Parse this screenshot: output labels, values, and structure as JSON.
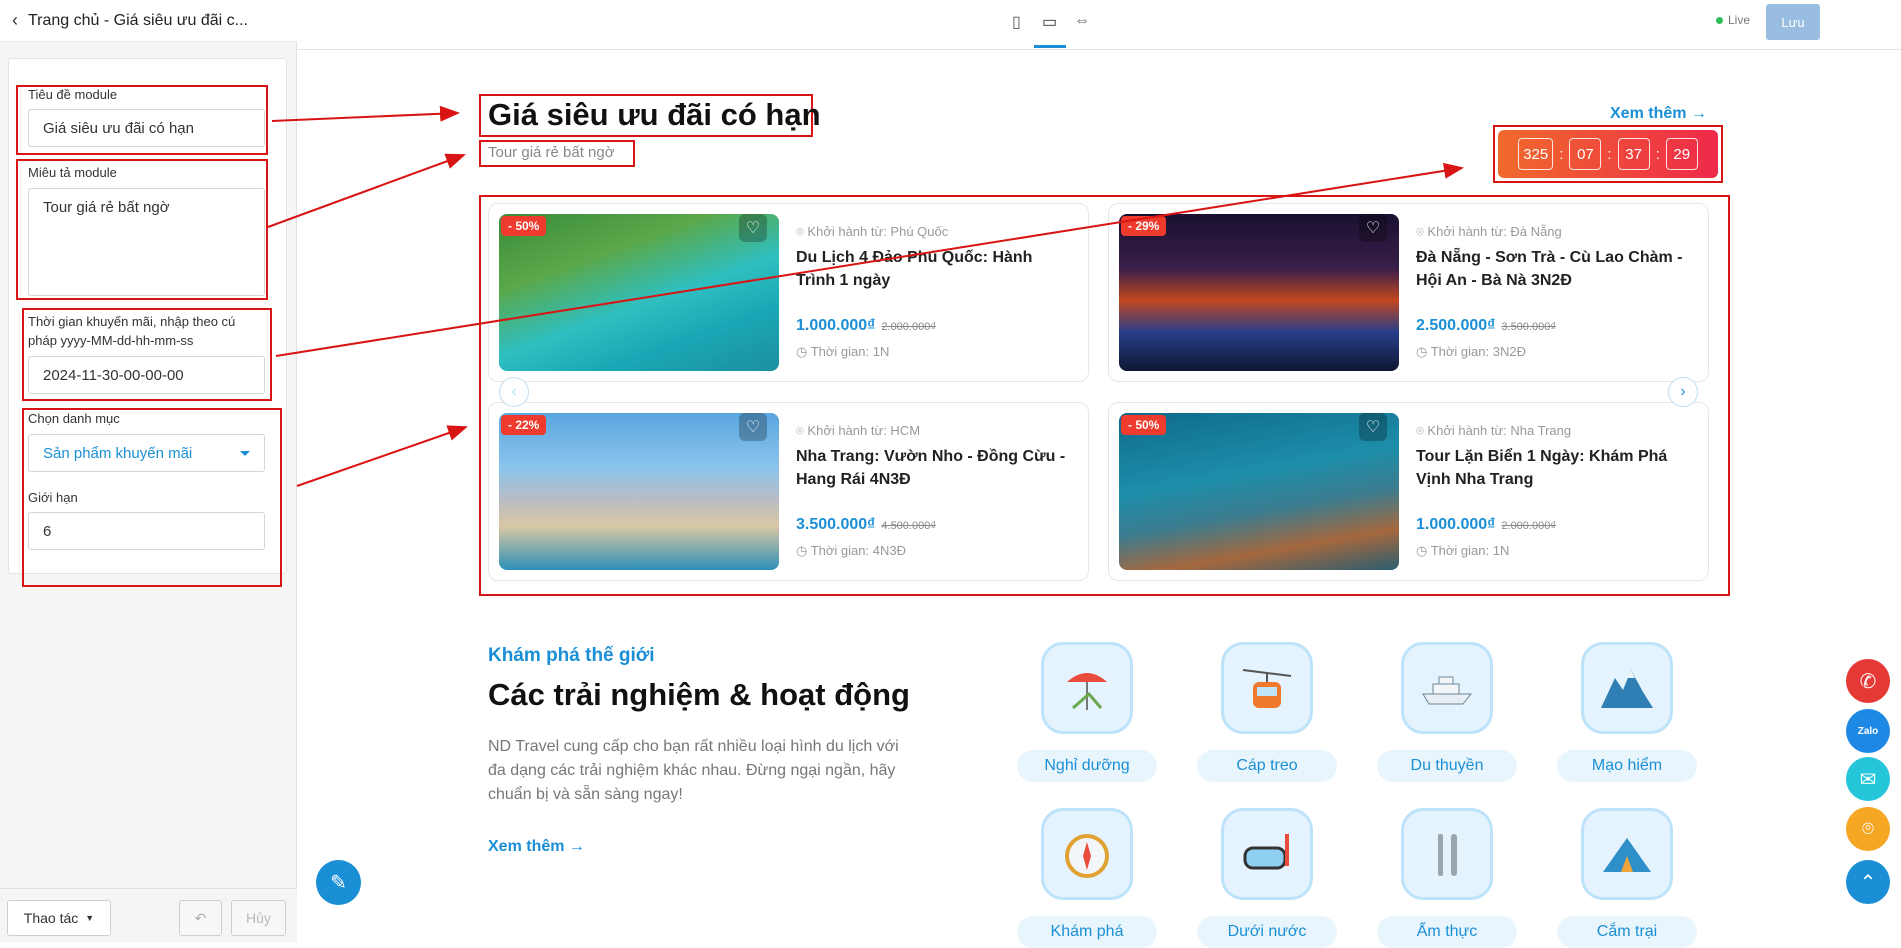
{
  "left_panel": {
    "back_icon": "chevron-left-icon",
    "title": "Trang chủ - Giá siêu ưu đãi c...",
    "fields": {
      "module_title_label": "Tiêu đề module",
      "module_title_value": "Giá siêu ưu đãi có hạn",
      "module_desc_label": "Miêu tả module",
      "module_desc_value": "Tour giá rẻ bất ngờ",
      "promo_time_label_line1": "Thời gian khuyến mãi, nhập theo cú",
      "promo_time_label_line2": "pháp yyyy-MM-dd-hh-mm-ss",
      "promo_time_value": "2024-11-30-00-00-00",
      "category_label": "Chọn danh mục",
      "category_value": "Sản phẩm khuyến mãi",
      "limit_label": "Giới hạn",
      "limit_value": "6"
    },
    "footer": {
      "actions_label": "Thao tác",
      "cancel_label": "Hủy"
    }
  },
  "topbar": {
    "devices": [
      "tablet-icon",
      "desktop-icon",
      "fit-width-icon"
    ],
    "live_label": "Live",
    "save_label": "Lưu",
    "accent": "#1b8fd6"
  },
  "deal_section": {
    "title": "Giá siêu ưu đãi có hạn",
    "subtitle": "Tour giá rẻ bất ngờ",
    "see_more": "Xem thêm",
    "countdown": {
      "days": "325",
      "hours": "07",
      "minutes": "37",
      "seconds": "29",
      "separator": ":"
    },
    "cards": [
      {
        "discount": "- 50%",
        "departure": "Khởi hành từ: Phú Quốc",
        "name": "Du Lịch 4 Đảo Phú Quốc: Hành Trình 1 ngày",
        "price": "1.000.000₫",
        "old_price": "2.000.000₫",
        "duration": "Thời gian: 1N"
      },
      {
        "discount": "- 29%",
        "departure": "Khởi hành từ: Đà Nẵng",
        "name": "Đà Nẵng - Sơn Trà - Cù Lao Chàm - Hội An - Bà Nà 3N2Đ",
        "price": "2.500.000₫",
        "old_price": "3.500.000₫",
        "duration": "Thời gian: 3N2Đ"
      },
      {
        "discount": "- 22%",
        "departure": "Khởi hành từ: HCM",
        "name": "Nha Trang: Vườn Nho - Đồng Cừu - Hang Rái 4N3Đ",
        "price": "3.500.000₫",
        "old_price": "4.500.000₫",
        "duration": "Thời gian: 4N3Đ"
      },
      {
        "discount": "- 50%",
        "departure": "Khởi hành từ: Nha Trang",
        "name": "Tour Lặn Biển 1 Ngày: Khám Phá Vịnh Nha Trang",
        "price": "1.000.000₫",
        "old_price": "2.000.000₫",
        "duration": "Thời gian: 1N"
      }
    ]
  },
  "experience_section": {
    "kicker": "Khám phá thế giới",
    "title": "Các trải nghiệm & hoạt động",
    "description": "ND Travel cung cấp cho bạn rất nhiều loại hình du lịch với đa dạng các trải nghiệm khác nhau. Đừng ngại ngần, hãy chuẩn bị và sẵn sàng ngay!",
    "see_more": "Xem thêm",
    "activities": [
      {
        "label": "Nghỉ dưỡng",
        "icon": "beach-chair-icon"
      },
      {
        "label": "Cáp treo",
        "icon": "cable-car-icon"
      },
      {
        "label": "Du thuyền",
        "icon": "yacht-icon"
      },
      {
        "label": "Mạo hiểm",
        "icon": "mountain-icon"
      },
      {
        "label": "Khám phá",
        "icon": "compass-icon"
      },
      {
        "label": "Dưới nước",
        "icon": "diving-mask-icon"
      },
      {
        "label": "Ẩm thực",
        "icon": "cutlery-icon"
      },
      {
        "label": "Cắm trại",
        "icon": "tent-icon"
      }
    ]
  },
  "floating": {
    "phone_color": "#e53935",
    "zalo_label": "Zalo",
    "zalo_color": "#1e88e5",
    "mail_color": "#26c6da",
    "map_color": "#f5a623",
    "top_color": "#1b8fd6"
  }
}
